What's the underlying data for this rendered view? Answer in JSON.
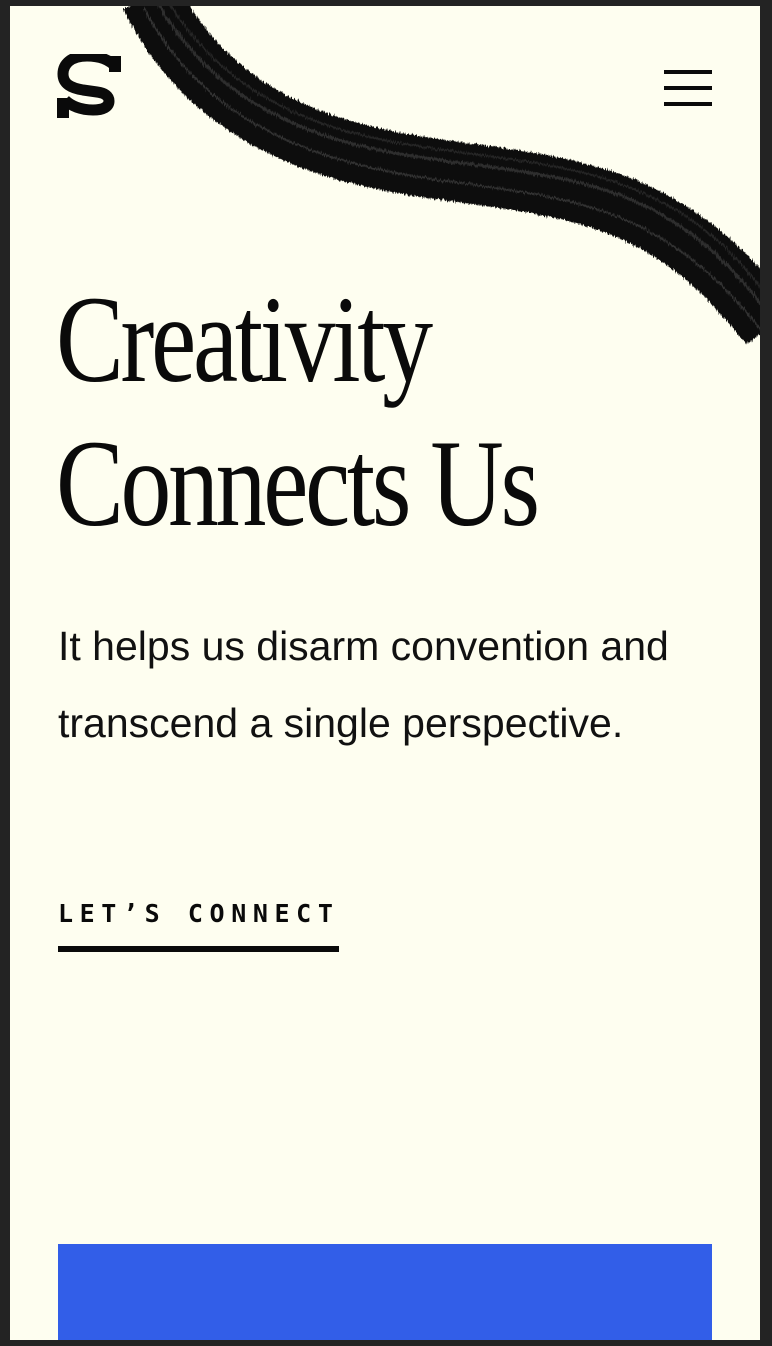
{
  "brand": {
    "logo_icon": "s-logo-icon"
  },
  "header": {
    "menu_icon": "hamburger-menu-icon"
  },
  "hero": {
    "headline_line1": "Creativity",
    "headline_line2": "Connects Us",
    "subcopy": "It helps us disarm convention and transcend a single perspective.",
    "cta_label": "LET’S CONNECT"
  },
  "colors": {
    "background": "#fefef0",
    "text": "#0a0a0a",
    "accent_blue": "#325ee8",
    "frame": "#232323"
  }
}
